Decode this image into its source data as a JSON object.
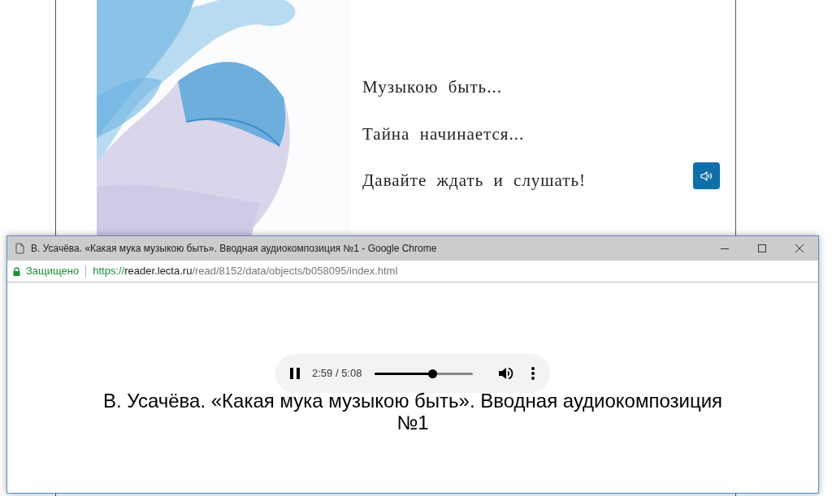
{
  "book_page": {
    "lines": [
      "Музыкою быть...",
      "Тайна начинается...",
      "Давайте ждать и слушать!"
    ]
  },
  "popup": {
    "title": "В. Усачёва. «Какая мука музыкою быть». Вводная аудиокомпозиция №1 - Google Chrome",
    "security": "Защищено",
    "url": {
      "scheme": "https://",
      "host": "reader.lecta.ru",
      "path": "/read/8152/data/objects/b058095/index.html"
    },
    "player": {
      "playing": true,
      "time": "2:59 / 5:08",
      "level": 0.58
    },
    "caption": "В. Усачёва. «Какая мука музыкою быть». Вводная аудиокомпозиция №1"
  }
}
